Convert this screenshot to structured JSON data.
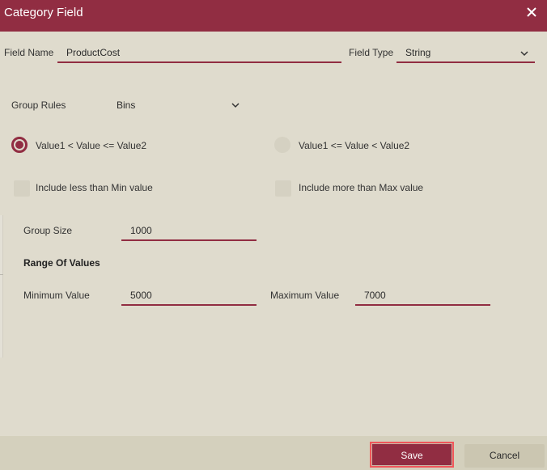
{
  "dialog": {
    "title": "Category Field",
    "close_icon": "close-icon"
  },
  "field_name": {
    "label": "Field Name",
    "value": "ProductCost"
  },
  "field_type": {
    "label": "Field Type",
    "value": "String",
    "icon": "chevron-down-icon"
  },
  "group_rules": {
    "label": "Group Rules",
    "value": "Bins",
    "icon": "chevron-down-icon"
  },
  "radios": [
    {
      "label": "Value1 < Value <= Value2",
      "selected": true
    },
    {
      "label": "Value1 <= Value < Value2",
      "selected": false
    }
  ],
  "checkboxes": [
    {
      "label": "Include less than Min value",
      "checked": false
    },
    {
      "label": "Include more than Max value",
      "checked": false
    }
  ],
  "group_size": {
    "label": "Group Size",
    "value": "1000"
  },
  "range": {
    "heading": "Range Of Values",
    "min": {
      "label": "Minimum Value",
      "value": "5000"
    },
    "max": {
      "label": "Maximum Value",
      "value": "7000"
    }
  },
  "footer": {
    "save_label": "Save",
    "cancel_label": "Cancel"
  },
  "colors": {
    "accent": "#912d42",
    "background": "#dfdbcd",
    "footer": "#d4d0bd",
    "focus_border": "#f0565a"
  }
}
